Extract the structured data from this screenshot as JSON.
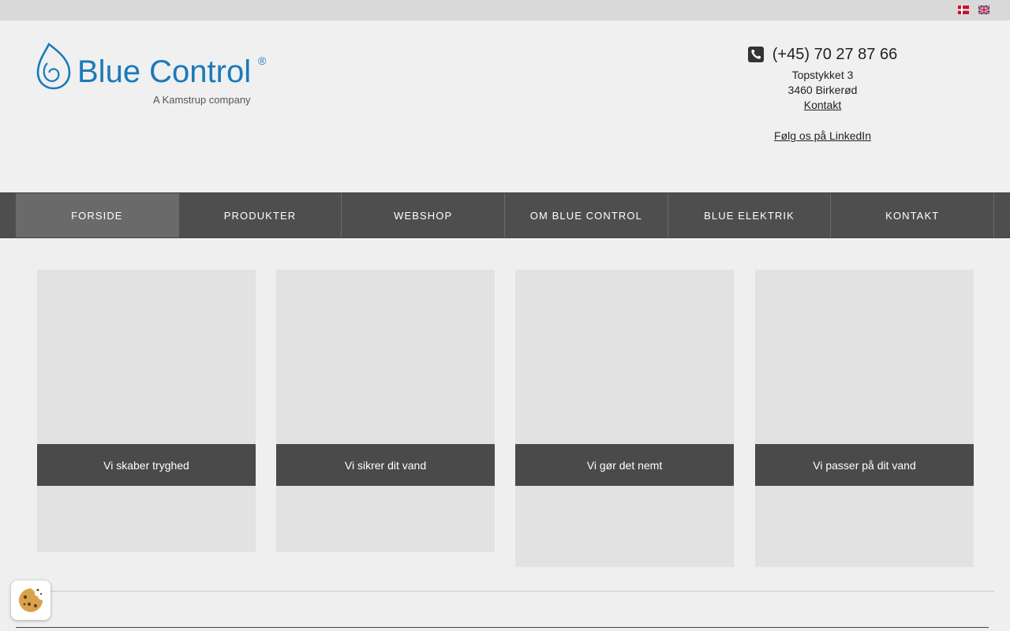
{
  "topbar": {
    "languages": [
      {
        "code": "da",
        "icon": "danish-flag-icon"
      },
      {
        "code": "en",
        "icon": "uk-flag-icon"
      }
    ]
  },
  "header": {
    "logo": {
      "name": "Blue Control",
      "tagline": "A Kamstrup company",
      "color": "#1a7ab8"
    },
    "contact": {
      "phone": "(+45) 70 27 87 66",
      "street": "Topstykket 3",
      "city": "3460 Birkerød",
      "contact_link": "Kontakt",
      "linkedin_link": "Følg os på LinkedIn"
    }
  },
  "nav": {
    "items": [
      {
        "label": "FORSIDE",
        "active": true
      },
      {
        "label": "PRODUKTER",
        "active": false
      },
      {
        "label": "WEBSHOP",
        "active": false
      },
      {
        "label": "OM BLUE CONTROL",
        "active": false
      },
      {
        "label": "BLUE ELEKTRIK",
        "active": false
      },
      {
        "label": "KONTAKT",
        "active": false
      }
    ]
  },
  "cards": [
    {
      "label": "Vi skaber tryghed"
    },
    {
      "label": "Vi sikrer dit vand"
    },
    {
      "label": "Vi gør det nemt"
    },
    {
      "label": "Vi passer på dit vand"
    }
  ],
  "cookie": {
    "icon": "cookie-icon"
  }
}
